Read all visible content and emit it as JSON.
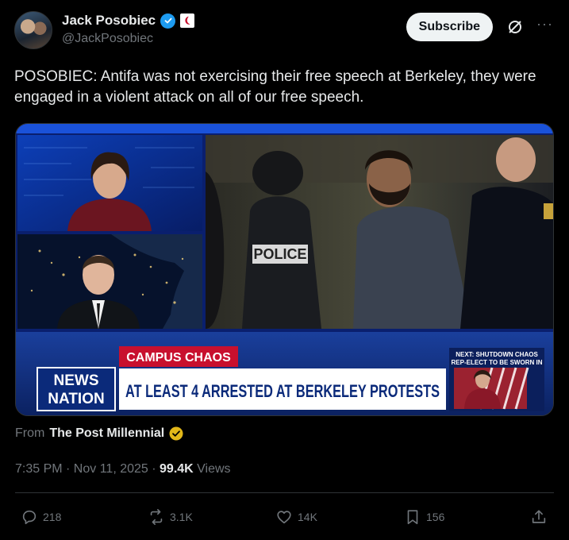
{
  "author": {
    "display_name": "Jack Posobiec",
    "handle": "@JackPosobiec"
  },
  "header": {
    "subscribe_label": "Subscribe",
    "grok_icon": "grok-icon",
    "more_label": "···"
  },
  "tweet": {
    "text": "POSOBIEC: Antifa was not exercising their free speech at Berkeley, they were engaged in a violent attack on all of our free speech."
  },
  "media": {
    "police_label": "POLICE",
    "banner_category": "CAMPUS CHAOS",
    "logo_top": "NEWS",
    "logo_bottom": "NATION",
    "headline": "AT LEAST 4 ARRESTED AT BERKELEY PROTESTS",
    "next_line1": "NEXT: SHUTDOWN CHAOS",
    "next_line2": "REP-ELECT TO BE SWORN IN"
  },
  "source": {
    "prefix": "From",
    "name": "The Post Millennial"
  },
  "meta": {
    "time": "7:35 PM · Nov 11, 2025 · ",
    "views_count": "99.4K",
    "views_label": " Views"
  },
  "actions": {
    "replies": "218",
    "reposts": "3.1K",
    "likes": "14K",
    "bookmarks": "156"
  },
  "colors": {
    "verified_blue": "#1d9bf0",
    "gold": "#e2b719",
    "background": "#000000",
    "muted": "#71767b"
  }
}
